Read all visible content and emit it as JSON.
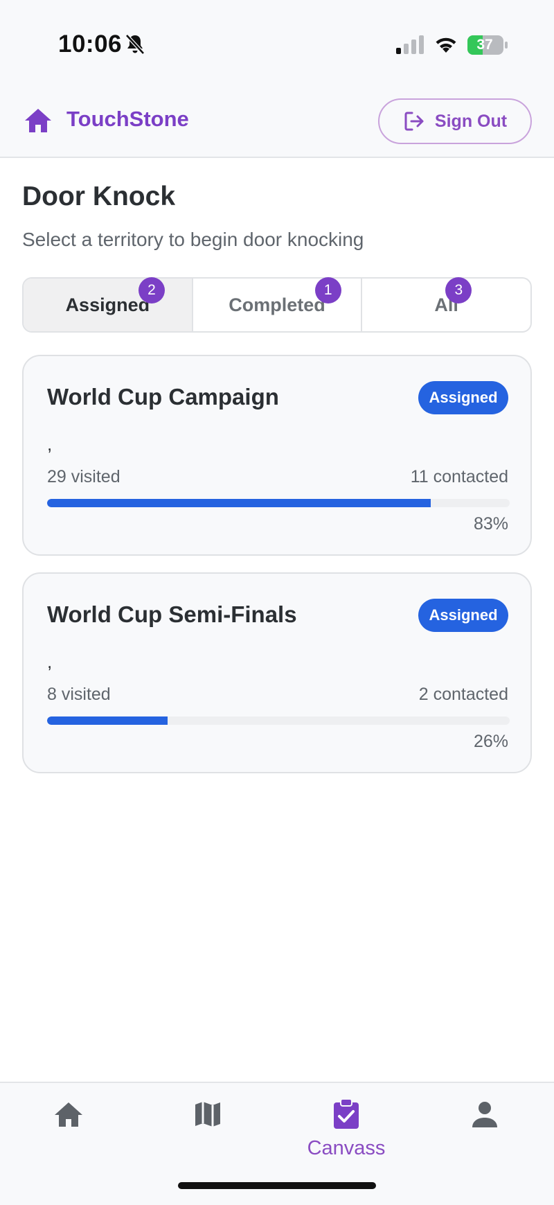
{
  "status_bar": {
    "time": "10:06",
    "battery": "37"
  },
  "header": {
    "brand": "TouchStone",
    "sign_out_label": "Sign Out"
  },
  "page": {
    "title": "Door Knock",
    "subtitle": "Select a territory to begin door knocking"
  },
  "tabs": [
    {
      "label": "Assigned",
      "badge": "2",
      "active": true
    },
    {
      "label": "Completed",
      "badge": "1",
      "active": false
    },
    {
      "label": "All",
      "badge": "3",
      "active": false
    }
  ],
  "territories": [
    {
      "name": "World Cup Campaign",
      "status": "Assigned",
      "address": ",",
      "visited": "29 visited",
      "contacted": "11 contacted",
      "progress_percent": 83,
      "progress_label": "83%"
    },
    {
      "name": "World Cup Semi-Finals",
      "status": "Assigned",
      "address": ",",
      "visited": "8 visited",
      "contacted": "2 contacted",
      "progress_percent": 26,
      "progress_label": "26%"
    }
  ],
  "bottom_nav": {
    "items": [
      {
        "icon": "home-icon",
        "label": ""
      },
      {
        "icon": "map-icon",
        "label": ""
      },
      {
        "icon": "clipboard-check-icon",
        "label": "Canvass",
        "active": true
      },
      {
        "icon": "person-icon",
        "label": ""
      }
    ]
  },
  "colors": {
    "brand_purple": "#7b3fc6",
    "accent_blue": "#2563e0",
    "battery_green": "#34c759"
  }
}
